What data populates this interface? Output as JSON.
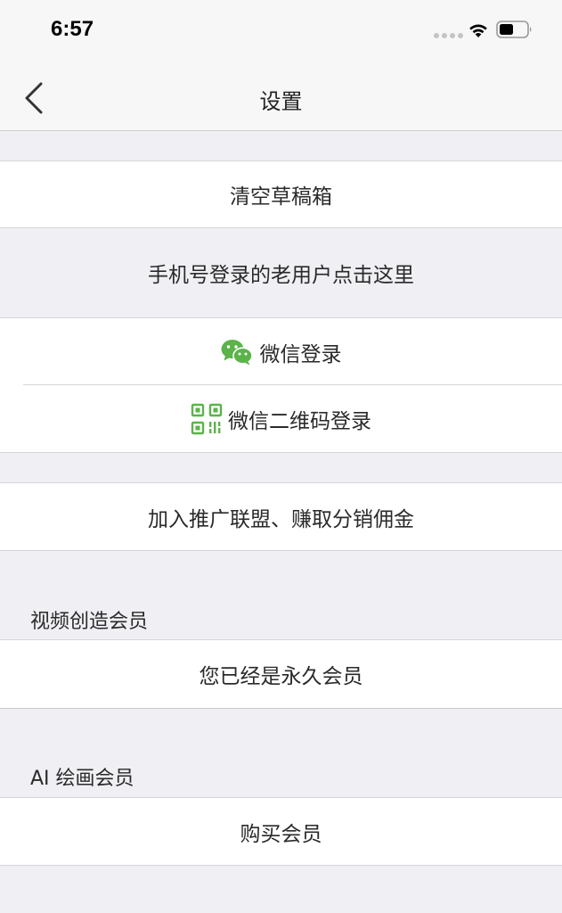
{
  "status": {
    "time": "6:57"
  },
  "nav": {
    "title": "设置"
  },
  "rows": {
    "clear_drafts": "清空草稿箱",
    "old_phone_login": "手机号登录的老用户点击这里",
    "wechat_login": "微信登录",
    "wechat_qr_login": "微信二维码登录",
    "join_affiliate": "加入推广联盟、赚取分销佣金"
  },
  "video_membership": {
    "section_title": "视频创造会员",
    "status": "您已经是永久会员"
  },
  "ai_membership": {
    "section_title": "AI 绘画会员",
    "buy": "购买会员"
  },
  "colors": {
    "wechat_green": "#5bb34a",
    "background": "#efeff4"
  },
  "icons": {
    "back": "chevron-left-icon",
    "wechat": "wechat-icon",
    "qr": "qr-code-icon"
  }
}
